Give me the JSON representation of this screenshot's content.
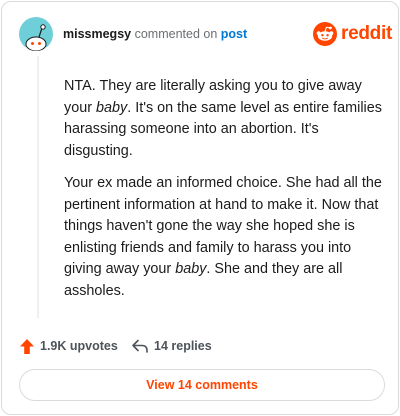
{
  "comment": {
    "username": "missmegsy",
    "action_text": "commented on",
    "post_link": "post",
    "paragraphs": [
      {
        "before": "NTA. They are literally asking you to give away your ",
        "emphasis": "baby",
        "after": ". It's on the same level as entire families harassing someone into an abortion. It's disgusting."
      },
      {
        "before": "Your ex made an informed choice. She had all the pertinent information at hand to make it. Now that things haven't gone the way she hoped she is enlisting friends and family to harass you into giving away your ",
        "emphasis": "baby",
        "after": ". She and they are all assholes."
      }
    ]
  },
  "brand": {
    "name": "reddit",
    "logo_icon": "reddit-alien-icon",
    "color": "#ff4500"
  },
  "actions": {
    "upvotes_label": "1.9K upvotes",
    "upvote_icon": "upvote-arrow-icon",
    "upvote_color": "#ff4500",
    "replies_label": "14 replies",
    "reply_icon": "reply-arrow-icon"
  },
  "view_comments_label": "View 14 comments",
  "avatar": {
    "icon": "snoo-avatar-icon",
    "background": "#6ecfd8"
  },
  "colors": {
    "link": "#0079d3",
    "accent": "#ff4500",
    "muted": "#6a6f73"
  }
}
